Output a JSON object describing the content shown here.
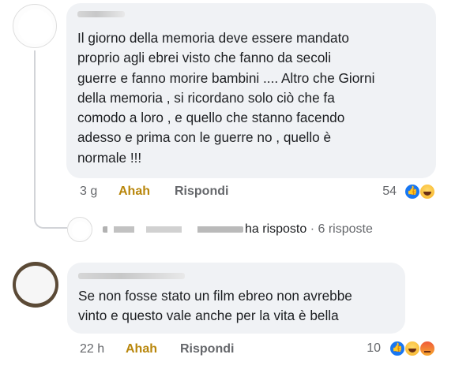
{
  "comment1": {
    "text": "Il giorno della memoria deve essere mandato\nproprio agli ebrei visto che fanno da secoli\nguerre e fanno morire bambini .... Altro che Giorni\ndella memoria , si ricordano solo ciò che fa\ncomodo a loro , e quello che stanno facendo\nadesso e prima con le guerre no , quello è\nnormale !!!",
    "time": "3 g",
    "reaction_label": "Ahah",
    "reply_label": "Rispondi",
    "reaction_count": "54",
    "reaction_icons": [
      "like-emoji",
      "haha-emoji"
    ],
    "replies_summary": {
      "action": "ha risposto",
      "separator": "·",
      "count": "6 risposte"
    }
  },
  "comment2": {
    "text": "Se non fosse stato un film ebreo non avrebbe\nvinto e questo vale anche per la vita è bella",
    "time": "22 h",
    "reaction_label": "Ahah",
    "reply_label": "Rispondi",
    "reaction_count": "10",
    "reaction_icons": [
      "like-emoji",
      "haha-emoji",
      "angry-emoji"
    ]
  },
  "colors": {
    "bubble": "#f0f2f5",
    "ahah": "#b8860b",
    "meta": "#65676b",
    "like": "#1877f2"
  }
}
